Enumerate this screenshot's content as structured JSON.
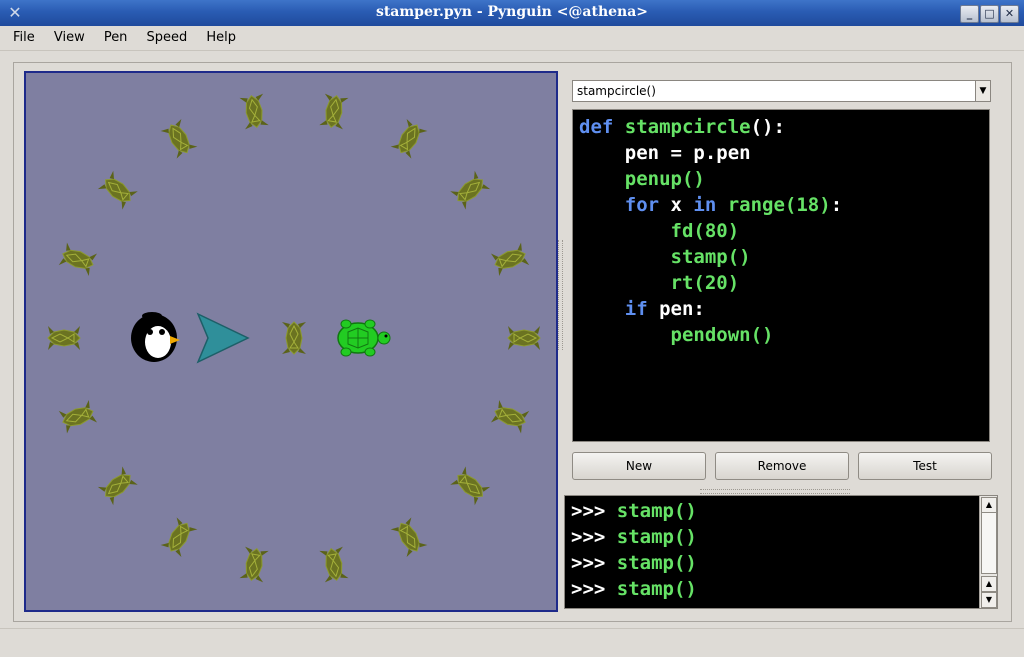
{
  "window": {
    "title": "stamper.pyn  - Pynguin <@athena>"
  },
  "menu": [
    "File",
    "View",
    "Pen",
    "Speed",
    "Help"
  ],
  "editor": {
    "selected_function": "stampcircle()",
    "code": [
      [
        [
          "kw",
          "def "
        ],
        [
          "fn",
          "stampcircle"
        ],
        [
          "nm",
          "():"
        ]
      ],
      [
        [
          "nm",
          "    pen = p.pen"
        ]
      ],
      [
        [
          "fn",
          "    penup()"
        ]
      ],
      [
        [
          "kw",
          "    for "
        ],
        [
          "nm",
          "x "
        ],
        [
          "kw",
          "in "
        ],
        [
          "fn",
          "range(18)"
        ],
        [
          "nm",
          ":"
        ]
      ],
      [
        [
          "fn",
          "        fd(80)"
        ]
      ],
      [
        [
          "fn",
          "        stamp()"
        ]
      ],
      [
        [
          "fn",
          "        rt(20)"
        ]
      ],
      [
        [
          "kw",
          "    if "
        ],
        [
          "nm",
          "pen:"
        ]
      ],
      [
        [
          "fn",
          "        pendown()"
        ]
      ]
    ]
  },
  "buttons": {
    "new": "New",
    "remove": "Remove",
    "test": "Test"
  },
  "console": {
    "prompt": ">>>",
    "lines": [
      "stamp()",
      "stamp()",
      "stamp()",
      "stamp()"
    ]
  },
  "colors": {
    "canvas_bg": "#7f7fa1",
    "stamp_turtle": "#6b7321",
    "live_turtle": "#22cc22",
    "arrow": "#2f8f9a"
  },
  "canvas": {
    "stamp_count": 18,
    "stamp_headings_deg": [
      0,
      20,
      40,
      60,
      80,
      100,
      120,
      140,
      160,
      180,
      200,
      220,
      240,
      260,
      280,
      300,
      320,
      340
    ],
    "icons": [
      "penguin-icon",
      "arrow-icon",
      "turtle-icon"
    ]
  }
}
